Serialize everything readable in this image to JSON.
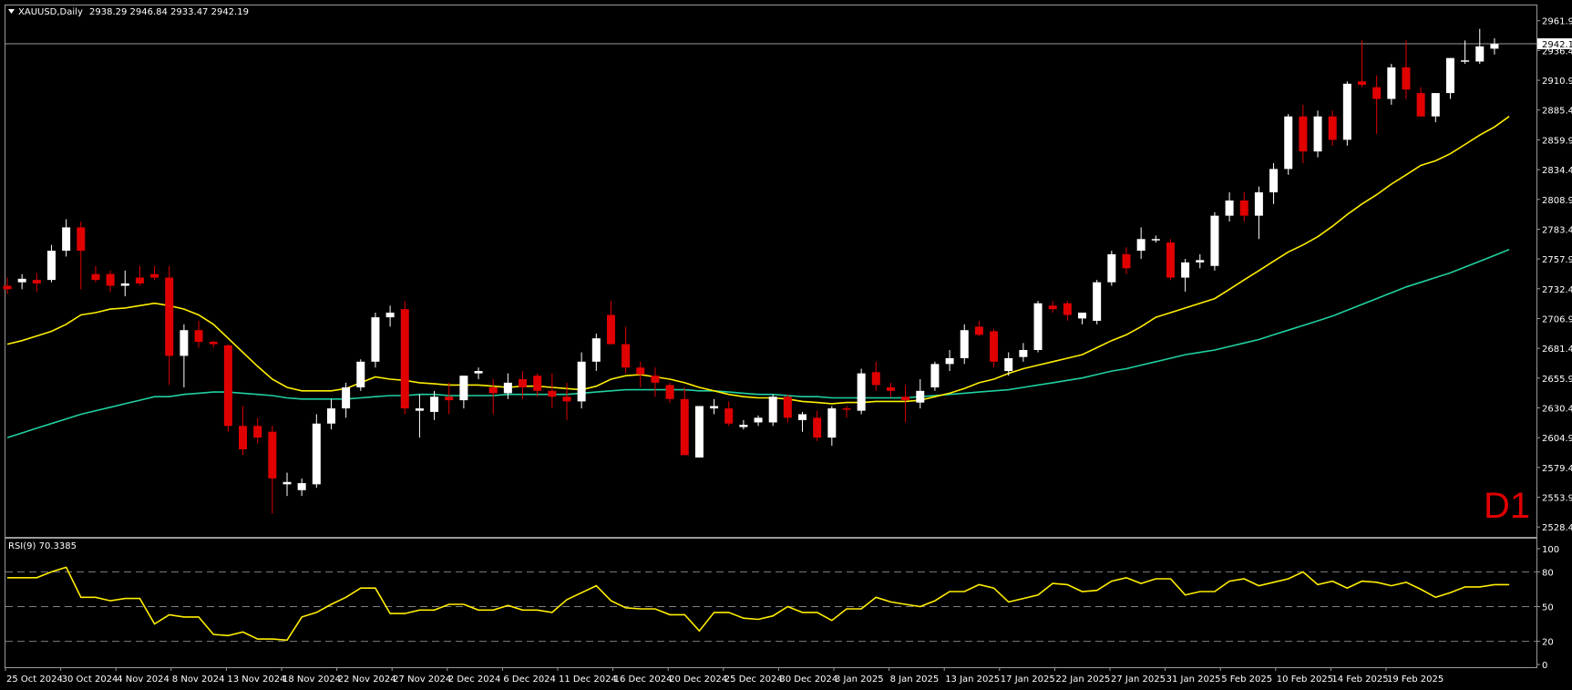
{
  "header": {
    "symbol": "XAUUSD,Daily",
    "ohlc": "2938.29 2946.84 2933.47 2942.19"
  },
  "timeframe_label": "D1",
  "colors": {
    "background": "#000000",
    "bull": "#ffffff",
    "bear": "#e00000",
    "ma_fast": "#ffee00",
    "ma_slow": "#20d0a0",
    "rsi": "#ffee00",
    "grid": "#7f7f7f"
  },
  "chart_data": [
    {
      "type": "candlestick",
      "title": "XAUUSD,Daily",
      "ylim": [
        2520,
        2975
      ],
      "yticks": [
        "2961.95",
        "2936.45",
        "2910.95",
        "2885.45",
        "2859.95",
        "2834.45",
        "2808.95",
        "2783.45",
        "2757.95",
        "2732.45",
        "2706.95",
        "2681.45",
        "2655.95",
        "2630.45",
        "2604.95",
        "2579.45",
        "2553.95",
        "2528.45"
      ],
      "current_price": "2942.19",
      "xlabels": [
        "25 Oct 2024",
        "30 Oct 2024",
        "4 Nov 2024",
        "8 Nov 2024",
        "13 Nov 2024",
        "18 Nov 2024",
        "22 Nov 2024",
        "27 Nov 2024",
        "2 Dec 2024",
        "6 Dec 2024",
        "11 Dec 2024",
        "16 Dec 2024",
        "20 Dec 2024",
        "25 Dec 2024",
        "30 Dec 2024",
        "3 Jan 2025",
        "8 Jan 2025",
        "13 Jan 2025",
        "17 Jan 2025",
        "22 Jan 2025",
        "27 Jan 2025",
        "31 Jan 2025",
        "5 Feb 2025",
        "10 Feb 2025",
        "14 Feb 2025",
        "19 Feb 2025"
      ],
      "candles": [
        [
          2735,
          2742,
          2728,
          2732
        ],
        [
          2738,
          2745,
          2732,
          2741
        ],
        [
          2740,
          2746,
          2730,
          2737
        ],
        [
          2740,
          2770,
          2738,
          2765
        ],
        [
          2765,
          2792,
          2760,
          2785
        ],
        [
          2785,
          2790,
          2732,
          2765
        ],
        [
          2745,
          2752,
          2738,
          2740
        ],
        [
          2745,
          2748,
          2730,
          2735
        ],
        [
          2735,
          2748,
          2726,
          2737
        ],
        [
          2742,
          2752,
          2735,
          2737
        ],
        [
          2745,
          2752,
          2740,
          2742
        ],
        [
          2742,
          2752,
          2650,
          2675
        ],
        [
          2675,
          2702,
          2648,
          2697
        ],
        [
          2697,
          2705,
          2682,
          2687
        ],
        [
          2687,
          2688,
          2682,
          2685
        ],
        [
          2684,
          2685,
          2610,
          2615
        ],
        [
          2615,
          2632,
          2590,
          2595
        ],
        [
          2615,
          2622,
          2600,
          2605
        ],
        [
          2610,
          2615,
          2540,
          2570
        ],
        [
          2565,
          2575,
          2555,
          2567
        ],
        [
          2560,
          2570,
          2555,
          2566
        ],
        [
          2565,
          2625,
          2562,
          2617
        ],
        [
          2617,
          2638,
          2612,
          2630
        ],
        [
          2630,
          2652,
          2622,
          2648
        ],
        [
          2648,
          2672,
          2645,
          2670
        ],
        [
          2670,
          2712,
          2665,
          2708
        ],
        [
          2708,
          2718,
          2700,
          2712
        ],
        [
          2715,
          2722,
          2625,
          2630
        ],
        [
          2628,
          2642,
          2605,
          2630
        ],
        [
          2627,
          2645,
          2620,
          2640
        ],
        [
          2640,
          2652,
          2625,
          2637
        ],
        [
          2637,
          2658,
          2630,
          2658
        ],
        [
          2660,
          2665,
          2655,
          2662
        ],
        [
          2648,
          2655,
          2625,
          2643
        ],
        [
          2643,
          2660,
          2638,
          2652
        ],
        [
          2655,
          2662,
          2638,
          2648
        ],
        [
          2658,
          2660,
          2640,
          2645
        ],
        [
          2645,
          2660,
          2630,
          2640
        ],
        [
          2640,
          2652,
          2620,
          2636
        ],
        [
          2636,
          2678,
          2630,
          2670
        ],
        [
          2670,
          2694,
          2662,
          2690
        ],
        [
          2710,
          2722,
          2685,
          2685
        ],
        [
          2685,
          2700,
          2660,
          2665
        ],
        [
          2665,
          2670,
          2648,
          2659
        ],
        [
          2658,
          2665,
          2640,
          2652
        ],
        [
          2650,
          2652,
          2635,
          2638
        ],
        [
          2638,
          2648,
          2590,
          2590
        ],
        [
          2588,
          2632,
          2588,
          2632
        ],
        [
          2630,
          2638,
          2625,
          2632
        ],
        [
          2630,
          2636,
          2615,
          2617
        ],
        [
          2614,
          2620,
          2612,
          2616
        ],
        [
          2618,
          2624,
          2615,
          2622
        ],
        [
          2618,
          2642,
          2615,
          2640
        ],
        [
          2640,
          2642,
          2618,
          2622
        ],
        [
          2620,
          2627,
          2610,
          2625
        ],
        [
          2622,
          2628,
          2602,
          2605
        ],
        [
          2605,
          2632,
          2598,
          2630
        ],
        [
          2630,
          2632,
          2622,
          2629
        ],
        [
          2628,
          2664,
          2625,
          2660
        ],
        [
          2661,
          2670,
          2645,
          2650
        ],
        [
          2648,
          2652,
          2640,
          2645
        ],
        [
          2640,
          2650,
          2618,
          2637
        ],
        [
          2635,
          2655,
          2630,
          2645
        ],
        [
          2648,
          2670,
          2645,
          2668
        ],
        [
          2668,
          2680,
          2662,
          2673
        ],
        [
          2673,
          2702,
          2668,
          2697
        ],
        [
          2700,
          2705,
          2692,
          2693
        ],
        [
          2696,
          2698,
          2665,
          2670
        ],
        [
          2662,
          2678,
          2658,
          2673
        ],
        [
          2674,
          2686,
          2670,
          2680
        ],
        [
          2680,
          2722,
          2678,
          2720
        ],
        [
          2718,
          2722,
          2712,
          2715
        ],
        [
          2720,
          2722,
          2705,
          2710
        ],
        [
          2707,
          2712,
          2702,
          2712
        ],
        [
          2705,
          2740,
          2702,
          2738
        ],
        [
          2738,
          2765,
          2735,
          2762
        ],
        [
          2762,
          2768,
          2745,
          2750
        ],
        [
          2765,
          2785,
          2758,
          2775
        ],
        [
          2775,
          2778,
          2772,
          2775
        ],
        [
          2772,
          2775,
          2740,
          2742
        ],
        [
          2742,
          2758,
          2730,
          2755
        ],
        [
          2755,
          2762,
          2750,
          2757
        ],
        [
          2752,
          2798,
          2748,
          2795
        ],
        [
          2795,
          2815,
          2790,
          2808
        ],
        [
          2808,
          2815,
          2790,
          2795
        ],
        [
          2795,
          2820,
          2775,
          2815
        ],
        [
          2815,
          2840,
          2805,
          2835
        ],
        [
          2835,
          2882,
          2830,
          2880
        ],
        [
          2880,
          2890,
          2840,
          2850
        ],
        [
          2850,
          2885,
          2845,
          2880
        ],
        [
          2880,
          2885,
          2855,
          2860
        ],
        [
          2860,
          2910,
          2855,
          2908
        ],
        [
          2910,
          2945,
          2905,
          2907
        ],
        [
          2905,
          2915,
          2865,
          2895
        ],
        [
          2895,
          2925,
          2890,
          2922
        ],
        [
          2922,
          2945,
          2895,
          2903
        ],
        [
          2900,
          2905,
          2880,
          2880
        ],
        [
          2880,
          2900,
          2875,
          2900
        ],
        [
          2900,
          2930,
          2895,
          2930
        ],
        [
          2928,
          2945,
          2925,
          2928
        ],
        [
          2927,
          2955,
          2925,
          2940
        ],
        [
          2938,
          2947,
          2933,
          2942
        ]
      ],
      "ma_fast": [
        2685,
        2688,
        2692,
        2696,
        2702,
        2710,
        2712,
        2715,
        2716,
        2718,
        2720,
        2718,
        2715,
        2710,
        2702,
        2690,
        2678,
        2666,
        2655,
        2648,
        2645,
        2645,
        2645,
        2647,
        2652,
        2657,
        2655,
        2654,
        2652,
        2651,
        2650,
        2650,
        2650,
        2649,
        2648,
        2649,
        2649,
        2648,
        2647,
        2646,
        2649,
        2655,
        2658,
        2659,
        2657,
        2655,
        2652,
        2648,
        2645,
        2642,
        2640,
        2639,
        2639,
        2638,
        2636,
        2635,
        2634,
        2635,
        2635,
        2636,
        2636,
        2636,
        2637,
        2640,
        2643,
        2647,
        2652,
        2655,
        2660,
        2664,
        2667,
        2670,
        2673,
        2676,
        2682,
        2688,
        2693,
        2700,
        2708,
        2712,
        2716,
        2720,
        2724,
        2732,
        2740,
        2748,
        2756,
        2764,
        2770,
        2777,
        2786,
        2796,
        2805,
        2813,
        2822,
        2830,
        2838,
        2842,
        2848,
        2856,
        2864,
        2871,
        2880
      ],
      "ma_slow": [
        2605,
        2609,
        2613,
        2617,
        2621,
        2625,
        2628,
        2631,
        2634,
        2637,
        2640,
        2640,
        2642,
        2643,
        2644,
        2644,
        2643,
        2642,
        2641,
        2639,
        2638,
        2638,
        2638,
        2638,
        2639,
        2640,
        2641,
        2641,
        2642,
        2642,
        2641,
        2641,
        2641,
        2641,
        2642,
        2642,
        2642,
        2642,
        2642,
        2643,
        2644,
        2645,
        2646,
        2646,
        2646,
        2646,
        2646,
        2645,
        2645,
        2644,
        2643,
        2642,
        2642,
        2641,
        2640,
        2640,
        2639,
        2639,
        2639,
        2639,
        2639,
        2639,
        2640,
        2641,
        2642,
        2643,
        2644,
        2645,
        2646,
        2648,
        2650,
        2652,
        2654,
        2656,
        2659,
        2662,
        2664,
        2667,
        2670,
        2673,
        2676,
        2678,
        2680,
        2683,
        2686,
        2689,
        2693,
        2697,
        2701,
        2705,
        2709,
        2714,
        2719,
        2724,
        2729,
        2734,
        2738,
        2742,
        2746,
        2751,
        2756,
        2761,
        2766
      ]
    },
    {
      "type": "line",
      "title": "RSI(9) 70.3385",
      "ylim": [
        0,
        100
      ],
      "yticks": [
        "100",
        "80",
        "50",
        "20",
        "0"
      ],
      "levels": [
        80,
        50,
        20
      ],
      "values": [
        75,
        75,
        75,
        80,
        84,
        58,
        58,
        55,
        57,
        57,
        35,
        43,
        41,
        41,
        26,
        25,
        28,
        22,
        22,
        21,
        41,
        45,
        52,
        58,
        66,
        66,
        44,
        44,
        47,
        47,
        52,
        52,
        47,
        47,
        51,
        47,
        47,
        45,
        56,
        62,
        68,
        55,
        49,
        48,
        48,
        43,
        43,
        29,
        45,
        45,
        40,
        39,
        42,
        50,
        45,
        45,
        38,
        48,
        48,
        58,
        54,
        52,
        50,
        55,
        63,
        63,
        69,
        66,
        54,
        57,
        60,
        70,
        69,
        63,
        64,
        72,
        75,
        70,
        74,
        74,
        60,
        63,
        63,
        72,
        74,
        68,
        71,
        74,
        80,
        69,
        72,
        66,
        72,
        71,
        68,
        71,
        65,
        58,
        62,
        67,
        67,
        69,
        69
      ]
    }
  ]
}
